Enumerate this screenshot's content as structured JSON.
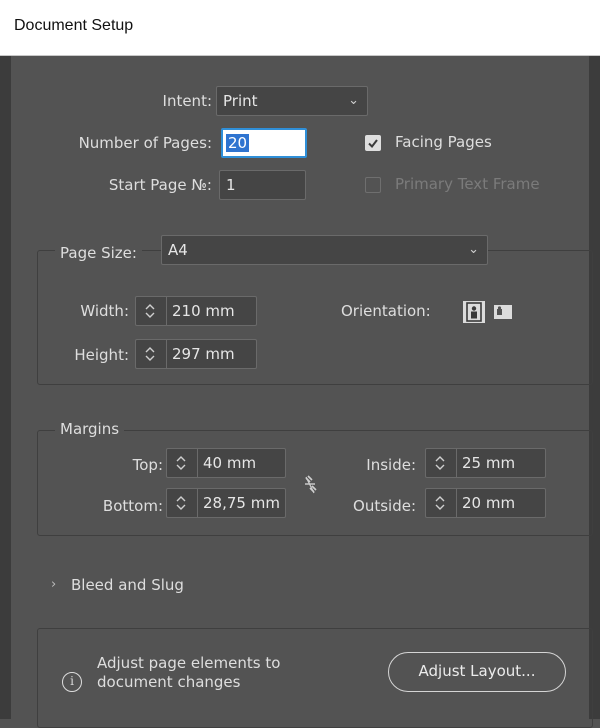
{
  "dialog": {
    "title": "Document Setup"
  },
  "intent": {
    "label": "Intent:",
    "value": "Print"
  },
  "pages": {
    "number_label": "Number of Pages:",
    "number_value": "20",
    "start_label": "Start Page №:",
    "start_value": "1",
    "facing_label": "Facing Pages",
    "facing_checked": true,
    "primary_label": "Primary Text Frame",
    "primary_checked": false,
    "primary_enabled": false
  },
  "page_size": {
    "label": "Page Size:",
    "value": "A4",
    "width_label": "Width:",
    "width_value": "210 mm",
    "height_label": "Height:",
    "height_value": "297 mm",
    "orientation_label": "Orientation:",
    "orientation_selected": "portrait"
  },
  "margins": {
    "legend": "Margins",
    "top_label": "Top:",
    "top_value": "40 mm",
    "bottom_label": "Bottom:",
    "bottom_value": "28,75 mm",
    "inside_label": "Inside:",
    "inside_value": "25 mm",
    "outside_label": "Outside:",
    "outside_value": "20 mm"
  },
  "bleed": {
    "label": "Bleed and Slug"
  },
  "adjust": {
    "text_line1": "Adjust page elements to",
    "text_line2": "document changes",
    "button_label": "Adjust Layout..."
  },
  "colors": {
    "panel": "#535353",
    "field": "#454545",
    "focus": "#2f8fd8",
    "selection": "#2f74d0"
  }
}
